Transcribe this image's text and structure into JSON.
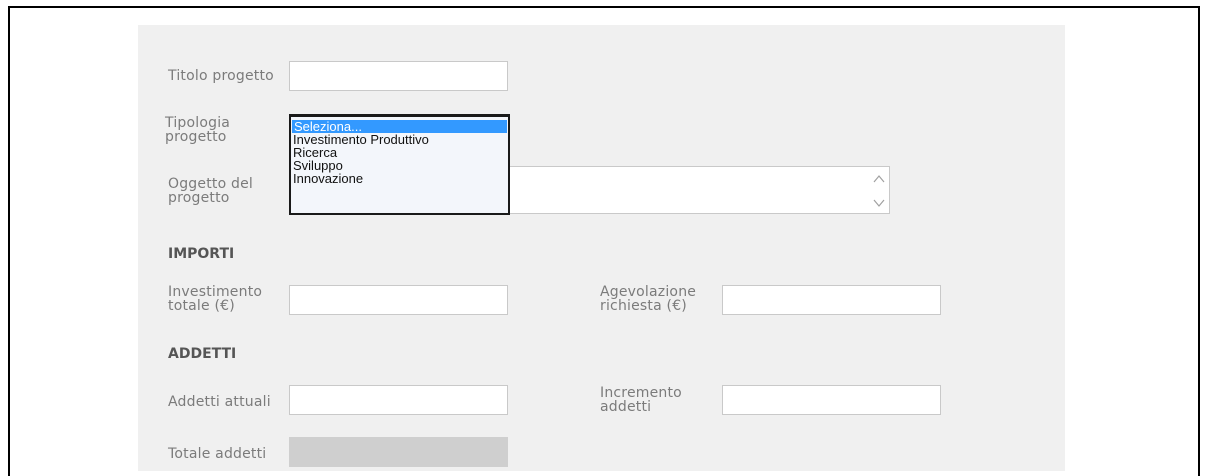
{
  "form": {
    "titolo_label": "Titolo progetto",
    "titolo_value": "",
    "tipologia_label": "Tipologia\nprogetto",
    "tipologia_options": [
      "Seleziona...",
      "Investimento Produttivo",
      "Ricerca",
      "Sviluppo",
      "Innovazione"
    ],
    "tipologia_selected": "Seleziona...",
    "oggetto_label": "Oggetto del\nprogetto",
    "oggetto_value": "",
    "importi_heading": "IMPORTI",
    "investimento_label": "Investimento\ntotale (€)",
    "investimento_value": "",
    "agevolazione_label": "Agevolazione\nrichiesta (€)",
    "agevolazione_value": "",
    "addetti_heading": "ADDETTI",
    "addetti_attuali_label": "Addetti attuali",
    "addetti_attuali_value": "",
    "incremento_label": "Incremento\naddetti",
    "incremento_value": "",
    "totale_label": "Totale addetti",
    "totale_value": ""
  },
  "icons": {
    "textarea_scroll_up": "chevron-up-icon",
    "textarea_scroll_down": "chevron-down-icon"
  },
  "colors": {
    "panel_bg": "#f0f0f0",
    "selected_option_bg": "#3399ff",
    "disabled_field_bg": "#cfcfcf"
  }
}
